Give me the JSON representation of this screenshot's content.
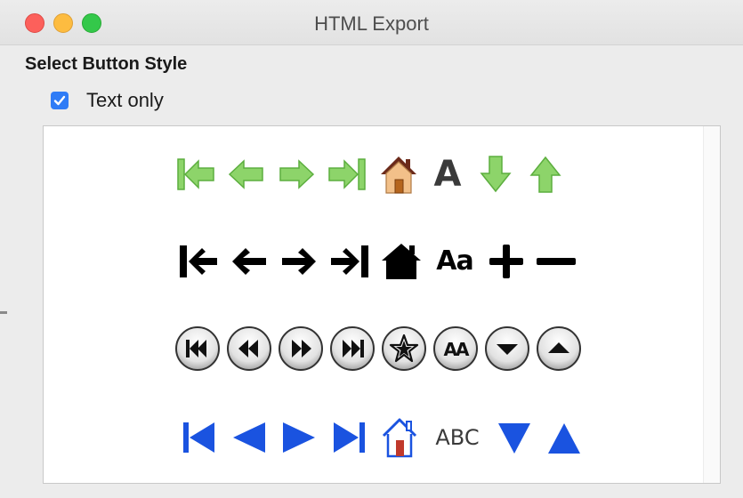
{
  "window": {
    "title": "HTML Export"
  },
  "section": {
    "heading": "Select Button Style"
  },
  "text_only": {
    "label": "Text only",
    "checked": true
  },
  "styles": [
    {
      "name": "green-arrows",
      "icons": [
        "first-page-icon",
        "previous-page-icon",
        "next-page-icon",
        "last-page-icon",
        "home-icon",
        "text-icon",
        "down-icon",
        "up-icon"
      ],
      "text_label": "A"
    },
    {
      "name": "black-bold",
      "icons": [
        "first-page-icon",
        "previous-page-icon",
        "next-page-icon",
        "last-page-icon",
        "home-icon",
        "text-icon",
        "plus-icon",
        "minus-icon"
      ],
      "text_label": "Aa"
    },
    {
      "name": "round-buttons",
      "icons": [
        "first-page-icon",
        "previous-page-icon",
        "next-page-icon",
        "last-page-icon",
        "star-icon",
        "text-icon",
        "down-icon",
        "up-icon"
      ],
      "text_label": "AA"
    },
    {
      "name": "blue-triangles",
      "icons": [
        "first-page-icon",
        "previous-page-icon",
        "next-page-icon",
        "last-page-icon",
        "home-icon",
        "text-icon",
        "down-icon",
        "up-icon"
      ],
      "text_label": "ABC"
    }
  ],
  "colors": {
    "green_arrow": "#8dd46a",
    "green_arrow_dark": "#5cae3e",
    "blue": "#1a53e0",
    "checkbox": "#2f7cf6",
    "close": "#fc605b",
    "minimize": "#fdbc40",
    "maximize": "#34c84a"
  }
}
